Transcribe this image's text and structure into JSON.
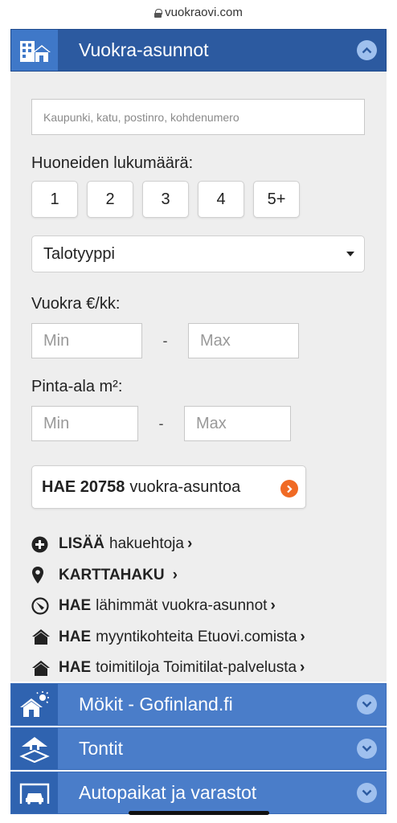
{
  "browser": {
    "url": "vuokraovi.com"
  },
  "rental": {
    "title": "Vuokra-asunnot",
    "search_placeholder": "Kaupunki, katu, postinro, kohdenumero",
    "rooms_label": "Huoneiden lukumäärä:",
    "room_options": [
      "1",
      "2",
      "3",
      "4",
      "5+"
    ],
    "house_type_selected": "Talotyyppi",
    "rent_label": "Vuokra €/kk:",
    "area_label": "Pinta-ala m²:",
    "min_placeholder": "Min",
    "max_placeholder": "Max",
    "range_separator": "-",
    "search_button": {
      "prefix": "HAE 20758",
      "suffix": "vuokra-asuntoa"
    }
  },
  "links": [
    {
      "bold": "LISÄÄ",
      "text": "hakuehtoja",
      "icon": "plus-circle-icon"
    },
    {
      "bold": "KARTTAHAKU",
      "text": "",
      "icon": "map-pin-icon"
    },
    {
      "bold": "HAE",
      "text": "lähimmät vuokra-asunnot",
      "icon": "compass-icon"
    },
    {
      "bold": "HAE",
      "text": "myyntikohteita Etuovi.comista",
      "icon": "house-icon"
    },
    {
      "bold": "HAE",
      "text": "toimitiloja Toimitilat-palvelusta",
      "icon": "house-icon"
    }
  ],
  "other_sections": [
    {
      "title": "Mökit - Gofinland.fi",
      "icon": "cottage-sun-icon"
    },
    {
      "title": "Tontit",
      "icon": "plot-icon"
    },
    {
      "title": "Autopaikat ja varastot",
      "icon": "car-garage-icon"
    }
  ],
  "chevron": "›",
  "colors": {
    "header": "#2c5aa0",
    "header_icon_bg": "#3f78c8",
    "panel_bg": "#eeeeee",
    "accent_orange": "#f06a24"
  }
}
